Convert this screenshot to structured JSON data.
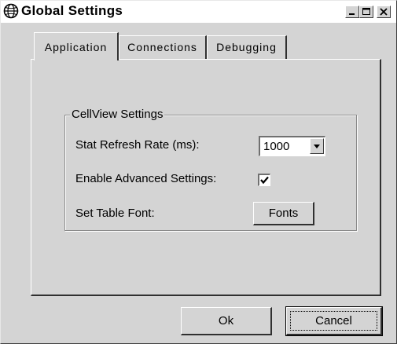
{
  "window": {
    "title": "Global Settings",
    "app_icon": "globe-icon",
    "controls": [
      "minimize-icon",
      "maximize-icon",
      "close-icon"
    ]
  },
  "tabs": [
    {
      "label": "Application",
      "active": true
    },
    {
      "label": "Connections",
      "active": false
    },
    {
      "label": "Debugging",
      "active": false
    }
  ],
  "group": {
    "legend": "CellView Settings",
    "stat_refresh_label": "Stat Refresh Rate (ms):",
    "stat_refresh_value": "1000",
    "advanced_label": "Enable Advanced Settings:",
    "advanced_checked": true,
    "table_font_label": "Set Table Font:",
    "fonts_button": "Fonts"
  },
  "buttons": {
    "ok": "Ok",
    "cancel": "Cancel"
  }
}
